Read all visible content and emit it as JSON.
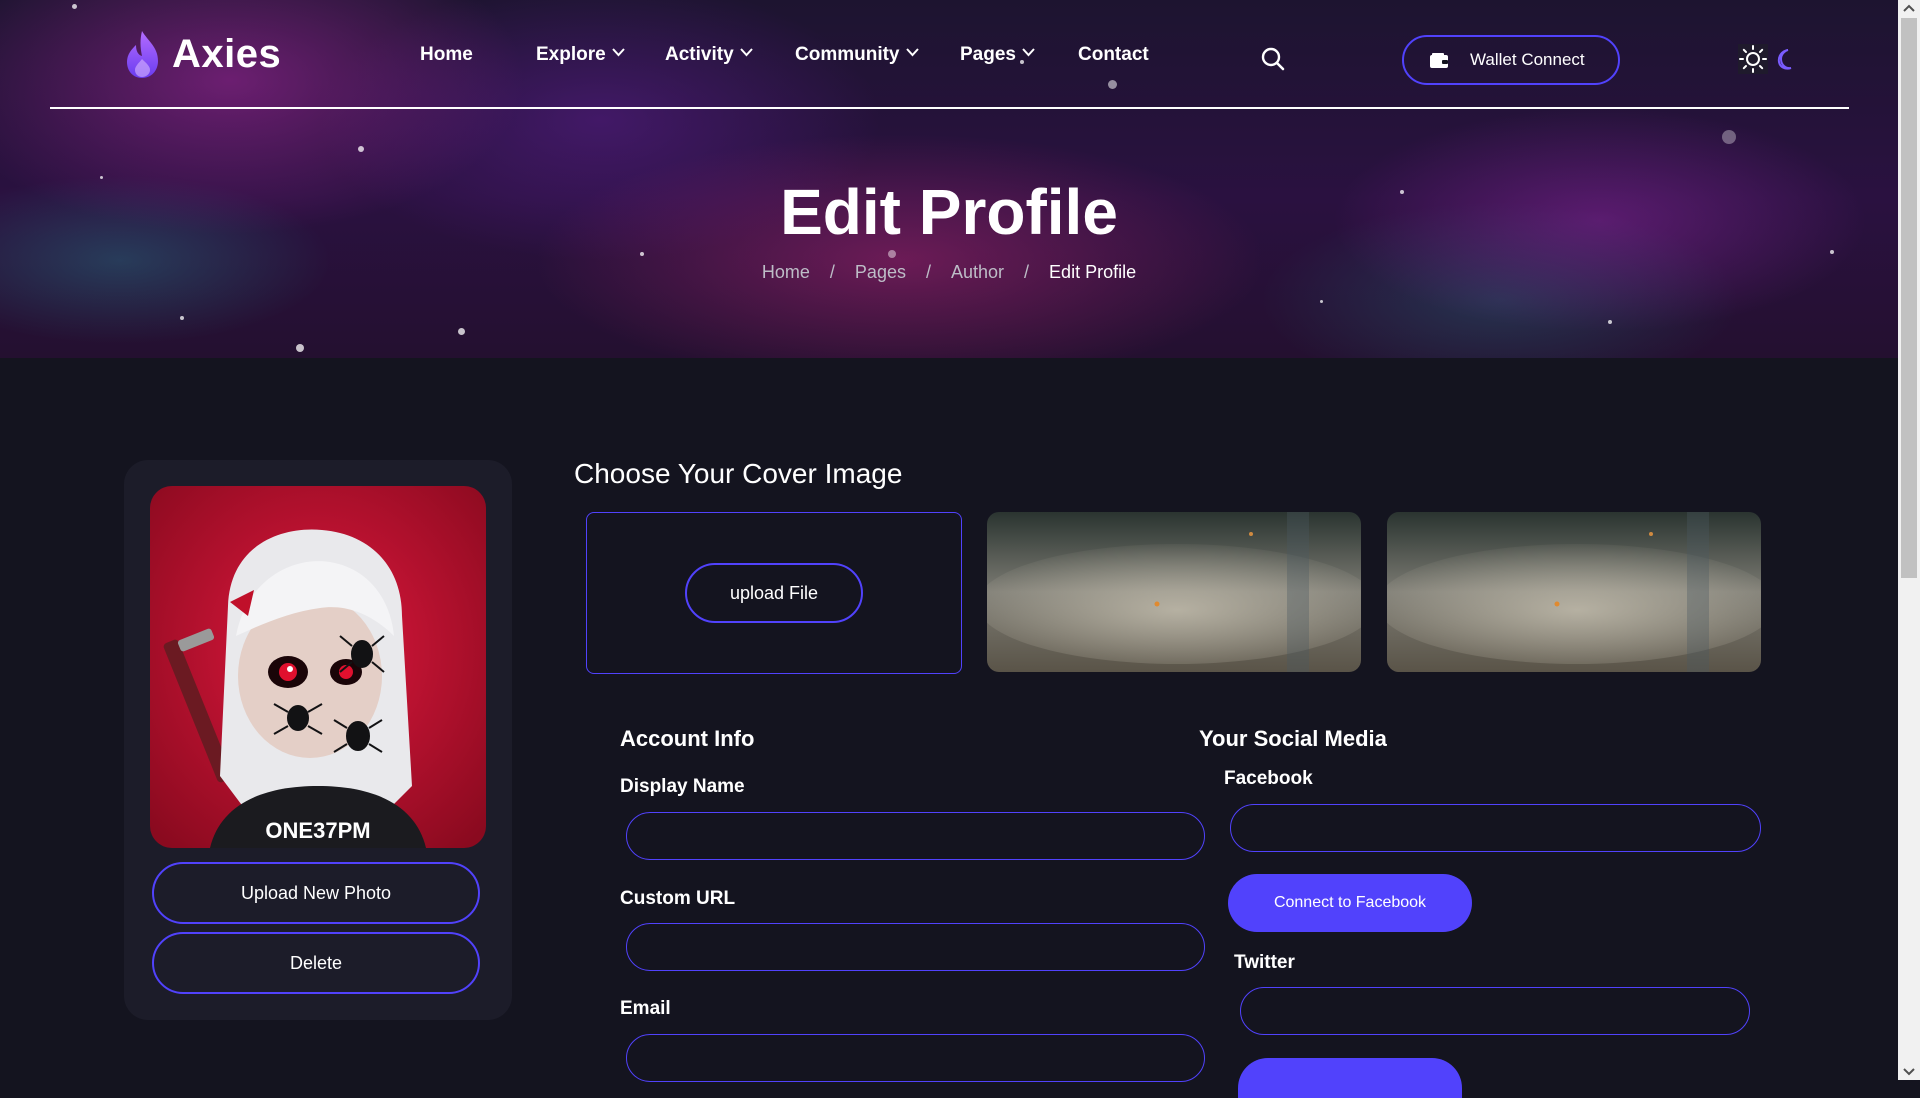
{
  "header": {
    "logo_text": "Axies",
    "nav": [
      {
        "label": "Home",
        "has_dropdown": false
      },
      {
        "label": "Explore",
        "has_dropdown": true
      },
      {
        "label": "Activity",
        "has_dropdown": true
      },
      {
        "label": "Community",
        "has_dropdown": true
      },
      {
        "label": "Pages",
        "has_dropdown": true
      },
      {
        "label": "Contact",
        "has_dropdown": false
      }
    ],
    "wallet_button": "Wallet Connect",
    "icons": {
      "search": "search-icon",
      "wallet": "wallet-icon",
      "light_mode": "sun-icon",
      "dark_mode": "moon-icon"
    }
  },
  "hero": {
    "title": "Edit Profile",
    "breadcrumb": [
      "Home",
      "Pages",
      "Author",
      "Edit Profile"
    ],
    "separator": "/"
  },
  "profile": {
    "avatar_badge_text": "ONE37PM",
    "upload_new_photo": "Upload New Photo",
    "delete": "Delete"
  },
  "cover": {
    "heading": "Choose Your Cover Image",
    "upload_button": "upload File"
  },
  "account_info": {
    "heading": "Account Info",
    "fields": [
      {
        "label": "Display Name",
        "value": ""
      },
      {
        "label": "Custom URL",
        "value": ""
      },
      {
        "label": "Email",
        "value": ""
      }
    ]
  },
  "social": {
    "heading": "Your Social Media",
    "facebook_label": "Facebook",
    "facebook_value": "",
    "facebook_connect": "Connect to Facebook",
    "twitter_label": "Twitter",
    "twitter_value": ""
  },
  "colors": {
    "accent": "#5142fc",
    "background": "#14141f",
    "card": "#1c1c29"
  }
}
